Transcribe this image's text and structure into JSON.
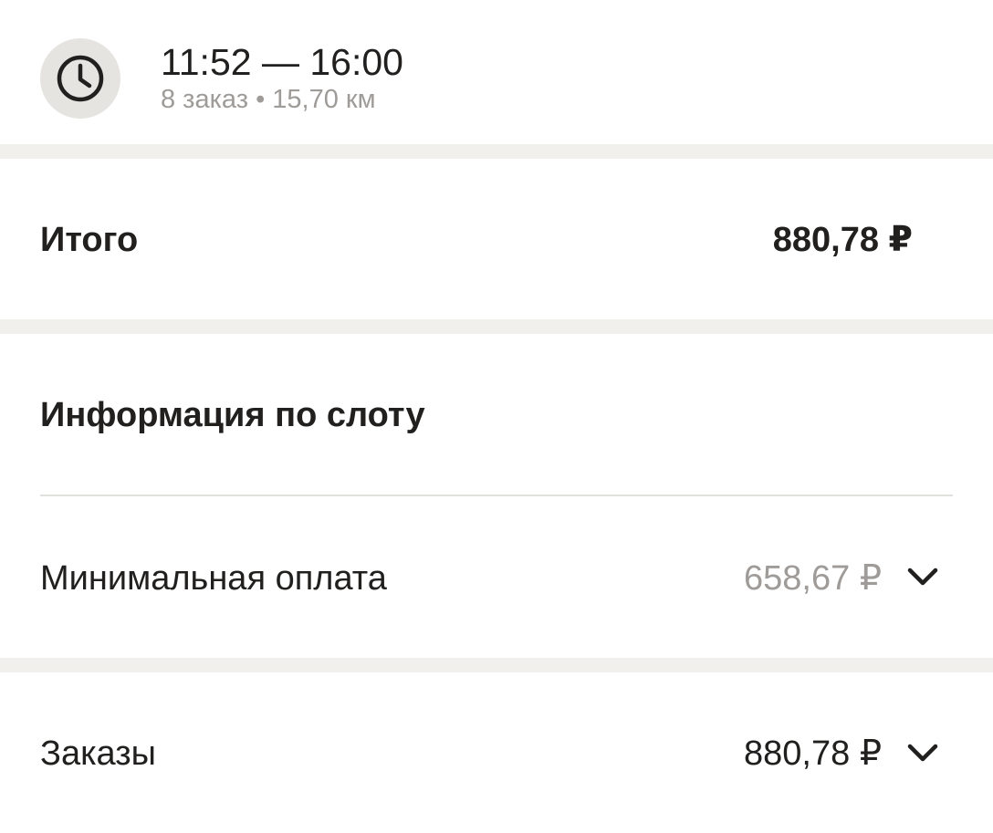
{
  "header": {
    "icon": "clock-icon",
    "time_range": "11:52 — 16:00",
    "meta": "8 заказ • 15,70 км"
  },
  "total": {
    "label": "Итого",
    "value": "880,78 ₽"
  },
  "slot_info": {
    "title": "Информация по слоту",
    "min_payment": {
      "label": "Минимальная оплата",
      "value": "658,67 ₽",
      "icon": "chevron-down-icon"
    }
  },
  "orders": {
    "label": "Заказы",
    "value": "880,78 ₽",
    "icon": "chevron-down-icon"
  },
  "colors": {
    "text_primary": "#21201f",
    "text_secondary": "#9e9b98",
    "separator": "#f1f0ed",
    "icon_bg": "#e6e4e0"
  }
}
